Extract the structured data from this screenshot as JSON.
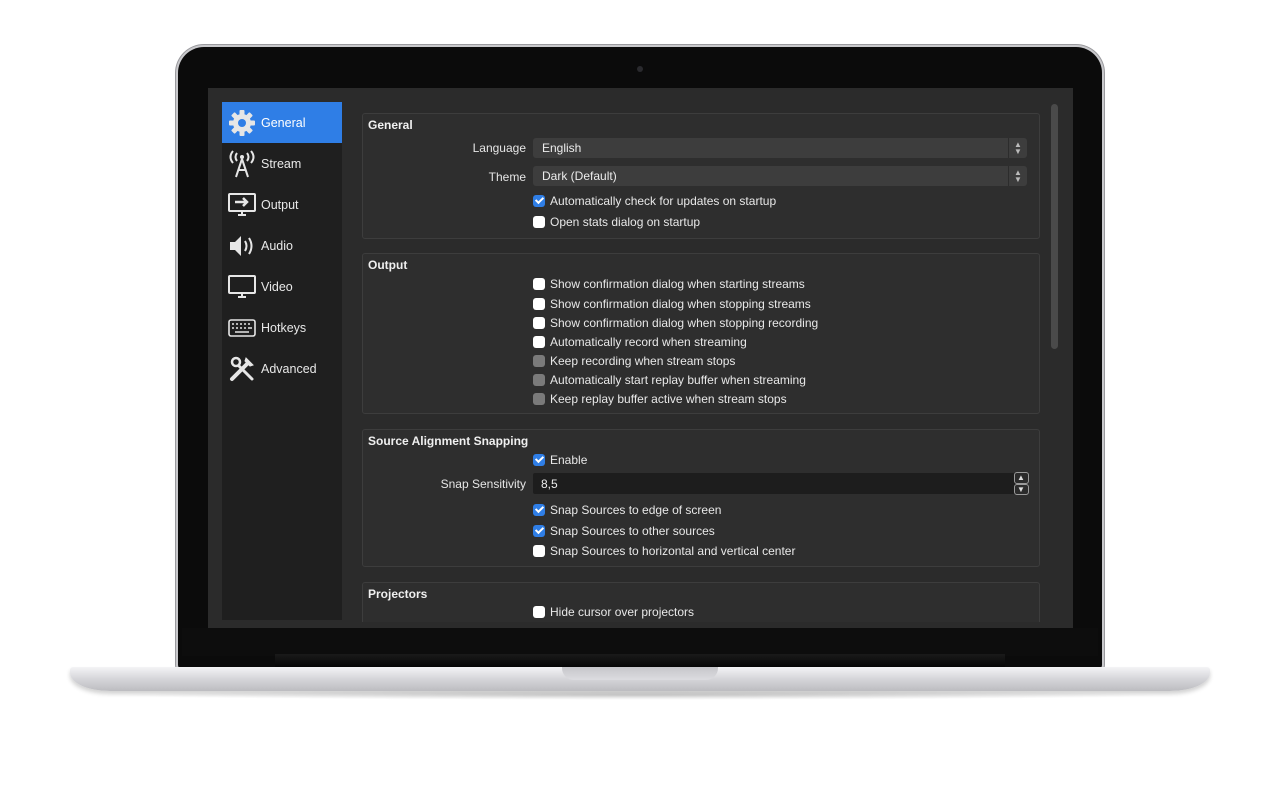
{
  "sidebar": {
    "items": [
      {
        "label": "General",
        "icon": "gear-icon",
        "active": true
      },
      {
        "label": "Stream",
        "icon": "broadcast-antenna-icon",
        "active": false
      },
      {
        "label": "Output",
        "icon": "monitor-output-icon",
        "active": false
      },
      {
        "label": "Audio",
        "icon": "speaker-icon",
        "active": false
      },
      {
        "label": "Video",
        "icon": "monitor-icon",
        "active": false
      },
      {
        "label": "Hotkeys",
        "icon": "keyboard-icon",
        "active": false
      },
      {
        "label": "Advanced",
        "icon": "tools-icon",
        "active": false
      }
    ]
  },
  "general": {
    "title": "General",
    "language_label": "Language",
    "language_value": "English",
    "theme_label": "Theme",
    "theme_value": "Dark (Default)",
    "auto_update": {
      "label": "Automatically check for updates on startup",
      "checked": true
    },
    "open_stats": {
      "label": "Open stats dialog on startup",
      "checked": false
    }
  },
  "output": {
    "title": "Output",
    "options": [
      {
        "label": "Show confirmation dialog when starting streams",
        "checked": false,
        "enabled": true
      },
      {
        "label": "Show confirmation dialog when stopping streams",
        "checked": false,
        "enabled": true
      },
      {
        "label": "Show confirmation dialog when stopping recording",
        "checked": false,
        "enabled": true
      },
      {
        "label": "Automatically record when streaming",
        "checked": false,
        "enabled": true
      },
      {
        "label": "Keep recording when stream stops",
        "checked": false,
        "enabled": false
      },
      {
        "label": "Automatically start replay buffer when streaming",
        "checked": false,
        "enabled": false
      },
      {
        "label": "Keep replay buffer active when stream stops",
        "checked": false,
        "enabled": false
      }
    ]
  },
  "snapping": {
    "title": "Source Alignment Snapping",
    "enable": {
      "label": "Enable",
      "checked": true
    },
    "sensitivity_label": "Snap Sensitivity",
    "sensitivity_value": "8,5",
    "options": [
      {
        "label": "Snap Sources to edge of screen",
        "checked": true
      },
      {
        "label": "Snap Sources to other sources",
        "checked": true
      },
      {
        "label": "Snap Sources to horizontal and vertical center",
        "checked": false
      }
    ]
  },
  "projectors": {
    "title": "Projectors",
    "hide_cursor": {
      "label": "Hide cursor over projectors",
      "checked": false
    }
  },
  "colors": {
    "accent": "#2f7ee6",
    "background": "#2b2b2b",
    "sidebar": "#1f1f1f",
    "group": "#2e2e2e"
  }
}
